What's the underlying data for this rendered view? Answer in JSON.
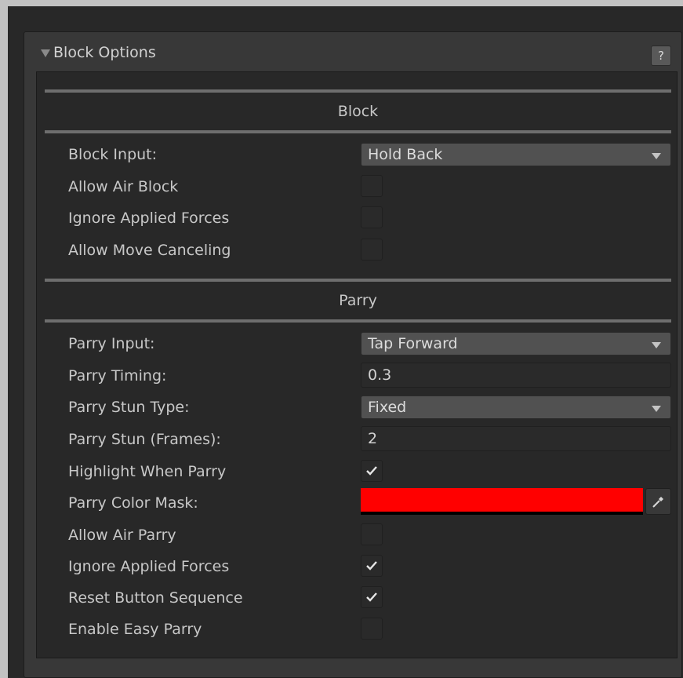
{
  "header": {
    "title": "Block Options",
    "help_label": "?"
  },
  "block_section": {
    "title": "Block",
    "rows": {
      "block_input": {
        "label": "Block Input:",
        "value": "Hold Back"
      },
      "allow_air_block": {
        "label": "Allow Air Block",
        "checked": false
      },
      "ignore_applied_forces": {
        "label": "Ignore Applied Forces",
        "checked": false
      },
      "allow_move_canceling": {
        "label": "Allow Move Canceling",
        "checked": false
      }
    }
  },
  "parry_section": {
    "title": "Parry",
    "rows": {
      "parry_input": {
        "label": "Parry Input:",
        "value": "Tap Forward"
      },
      "parry_timing": {
        "label": "Parry Timing:",
        "value": "0.3"
      },
      "parry_stun_type": {
        "label": "Parry Stun Type:",
        "value": "Fixed"
      },
      "parry_stun_frames": {
        "label": "Parry Stun (Frames):",
        "value": "2"
      },
      "highlight_when_parry": {
        "label": "Highlight When Parry",
        "checked": true
      },
      "parry_color_mask": {
        "label": "Parry Color Mask:",
        "color": "#ff0000"
      },
      "allow_air_parry": {
        "label": "Allow Air Parry",
        "checked": false
      },
      "ignore_applied_forces": {
        "label": "Ignore Applied Forces",
        "checked": true
      },
      "reset_button_sequence": {
        "label": "Reset Button Sequence",
        "checked": true
      },
      "enable_easy_parry": {
        "label": "Enable Easy Parry",
        "checked": false
      }
    }
  },
  "icons": {
    "foldout": "triangle-down-icon",
    "dropdown": "chevron-down-icon",
    "checkmark": "checkmark-icon",
    "eyedropper": "eyedropper-icon"
  },
  "colors": {
    "panel_bg": "#383838",
    "inner_bg": "#282828",
    "text": "#c8c8c8",
    "divider": "#6e6e6e"
  }
}
